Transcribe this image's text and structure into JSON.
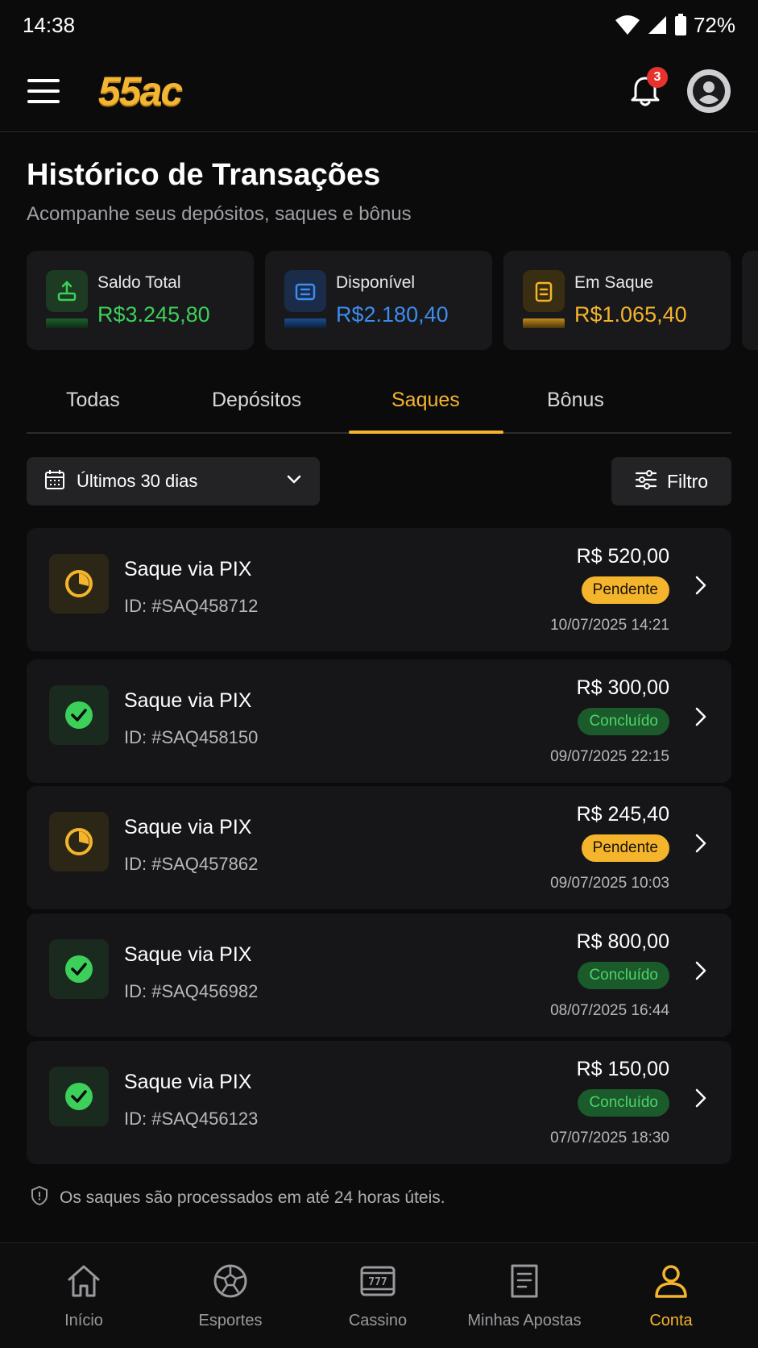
{
  "status_bar": {
    "time": "14:38",
    "battery": "72%"
  },
  "header": {
    "logo": "55ac",
    "notification_count": "3"
  },
  "page": {
    "title": "Histórico de Transações",
    "subtitle": "Acompanhe seus depósitos, saques e bônus"
  },
  "summary": [
    {
      "label": "Saldo Total",
      "value": "R$3.245,80",
      "color": "#3ccf5a"
    },
    {
      "label": "Disponível",
      "value": "R$2.180,40",
      "color": "#3d8cf0"
    },
    {
      "label": "Em Saque",
      "value": "R$1.065,40",
      "color": "#f4b42c"
    }
  ],
  "tabs": [
    {
      "label": "Todas"
    },
    {
      "label": "Depósitos"
    },
    {
      "label": "Saques",
      "active": true
    },
    {
      "label": "Bônus"
    }
  ],
  "filters": {
    "period": "Últimos 30 dias",
    "filter_label": "Filtro"
  },
  "transactions": [
    {
      "title": "Saque via PIX",
      "id": "ID: #SAQ458712",
      "amount": "R$ 520,00",
      "status": "Pendente",
      "date": "10/07/2025 14:21"
    },
    {
      "title": "Saque via PIX",
      "id": "ID: #SAQ458150",
      "amount": "R$ 300,00",
      "status": "Concluído",
      "date": "09/07/2025 22:15"
    },
    {
      "title": "Saque via PIX",
      "id": "ID: #SAQ457862",
      "amount": "R$ 245,40",
      "status": "Pendente",
      "date": "09/07/2025 10:03"
    },
    {
      "title": "Saque via PIX",
      "id": "ID: #SAQ456982",
      "amount": "R$ 800,00",
      "status": "Concluído",
      "date": "08/07/2025 16:44"
    },
    {
      "title": "Saque via PIX",
      "id": "ID: #SAQ456123",
      "amount": "R$ 150,00",
      "status": "Concluído",
      "date": "07/07/2025 18:30"
    }
  ],
  "footnote": "Os saques são processados em até 24 horas úteis.",
  "bottom_nav": [
    {
      "label": "Início",
      "icon": "home-icon"
    },
    {
      "label": "Esportes",
      "icon": "soccer-ball-icon"
    },
    {
      "label": "Cassino",
      "icon": "slot-machine-icon"
    },
    {
      "label": "Minhas Apostas",
      "icon": "bet-slip-icon"
    },
    {
      "label": "Conta",
      "icon": "user-icon",
      "active": true
    }
  ],
  "colors": {
    "accent": "#f4b42c",
    "success": "#3ccf5a",
    "info": "#3d8cf0",
    "background": "#0b0b0c"
  }
}
